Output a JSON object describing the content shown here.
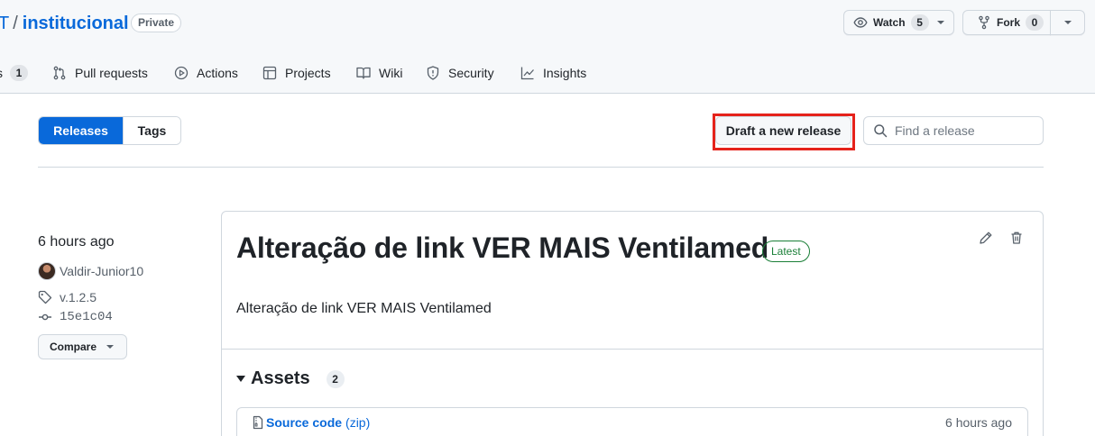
{
  "repo": {
    "owner_fragment": "T",
    "separator": "/",
    "name": "institucional",
    "visibility": "Private"
  },
  "actions": {
    "watch_label": "Watch",
    "watch_count": "5",
    "fork_label": "Fork",
    "fork_count": "0"
  },
  "tabs": [
    {
      "label": "s",
      "count": "1",
      "icon": "issues-icon"
    },
    {
      "label": "Pull requests",
      "icon": "pull-request-icon"
    },
    {
      "label": "Actions",
      "icon": "play-icon"
    },
    {
      "label": "Projects",
      "icon": "table-icon"
    },
    {
      "label": "Wiki",
      "icon": "book-icon"
    },
    {
      "label": "Security",
      "icon": "shield-icon"
    },
    {
      "label": "Insights",
      "icon": "graph-icon"
    }
  ],
  "subnav": {
    "releases_label": "Releases",
    "tags_label": "Tags",
    "draft_label": "Draft a new release",
    "search_placeholder": "Find a release"
  },
  "release": {
    "time": "6 hours ago",
    "author": "Valdir-Junior10",
    "tag": "v.1.2.5",
    "commit": "15e1c04",
    "compare_label": "Compare",
    "title": "Alteração de link VER MAIS Ventilamed",
    "badge": "Latest",
    "body": "Alteração de link VER MAIS Ventilamed",
    "assets_label": "Assets",
    "assets_count": "2",
    "assets": [
      {
        "name": "Source code",
        "format": "(zip)",
        "time": "6 hours ago"
      }
    ]
  },
  "colors": {
    "link": "#0969da",
    "primary": "#0969da",
    "latest_green": "#1a7f37",
    "highlight_red": "#e5221b"
  }
}
